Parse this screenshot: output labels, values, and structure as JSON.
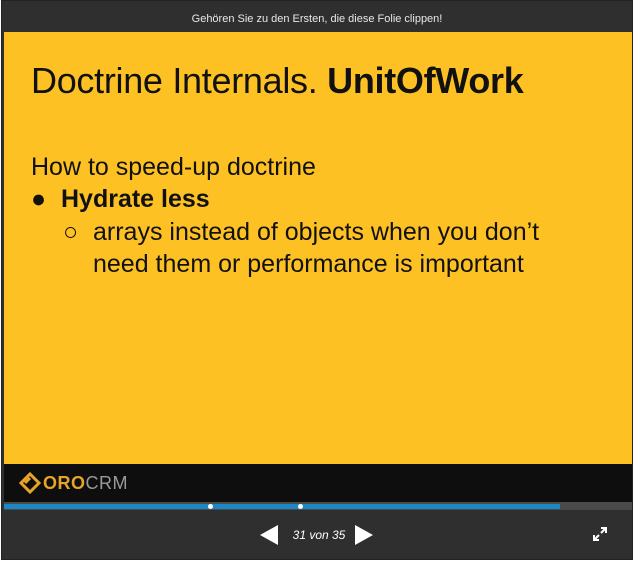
{
  "top_bar": {
    "clip_prompt": "Gehören Sie zu den Ersten, die diese Folie clippen!"
  },
  "slide": {
    "title_normal": "Doctrine Internals. ",
    "title_bold": "UnitOfWork",
    "subhead": "How to speed-up doctrine",
    "bullet_symbol": "●",
    "bullet": "Hydrate less",
    "sub_bullet_symbol": "○",
    "sub_bullet": "arrays instead of objects when you don’t need them or performance is important",
    "background_color": "#fdc123"
  },
  "footer": {
    "logo_oro": "ORO",
    "logo_crm": "CRM"
  },
  "navigation": {
    "current_slide": 31,
    "total_slides": 35,
    "counter_text": "31 von 35",
    "progress_fraction": 0.886,
    "accent_color": "#1d86c4"
  },
  "icons": {
    "prev": "triangle-left-icon",
    "next": "triangle-right-icon",
    "fullscreen": "expand-arrows-icon",
    "logo": "orocrm-logo-mark"
  }
}
